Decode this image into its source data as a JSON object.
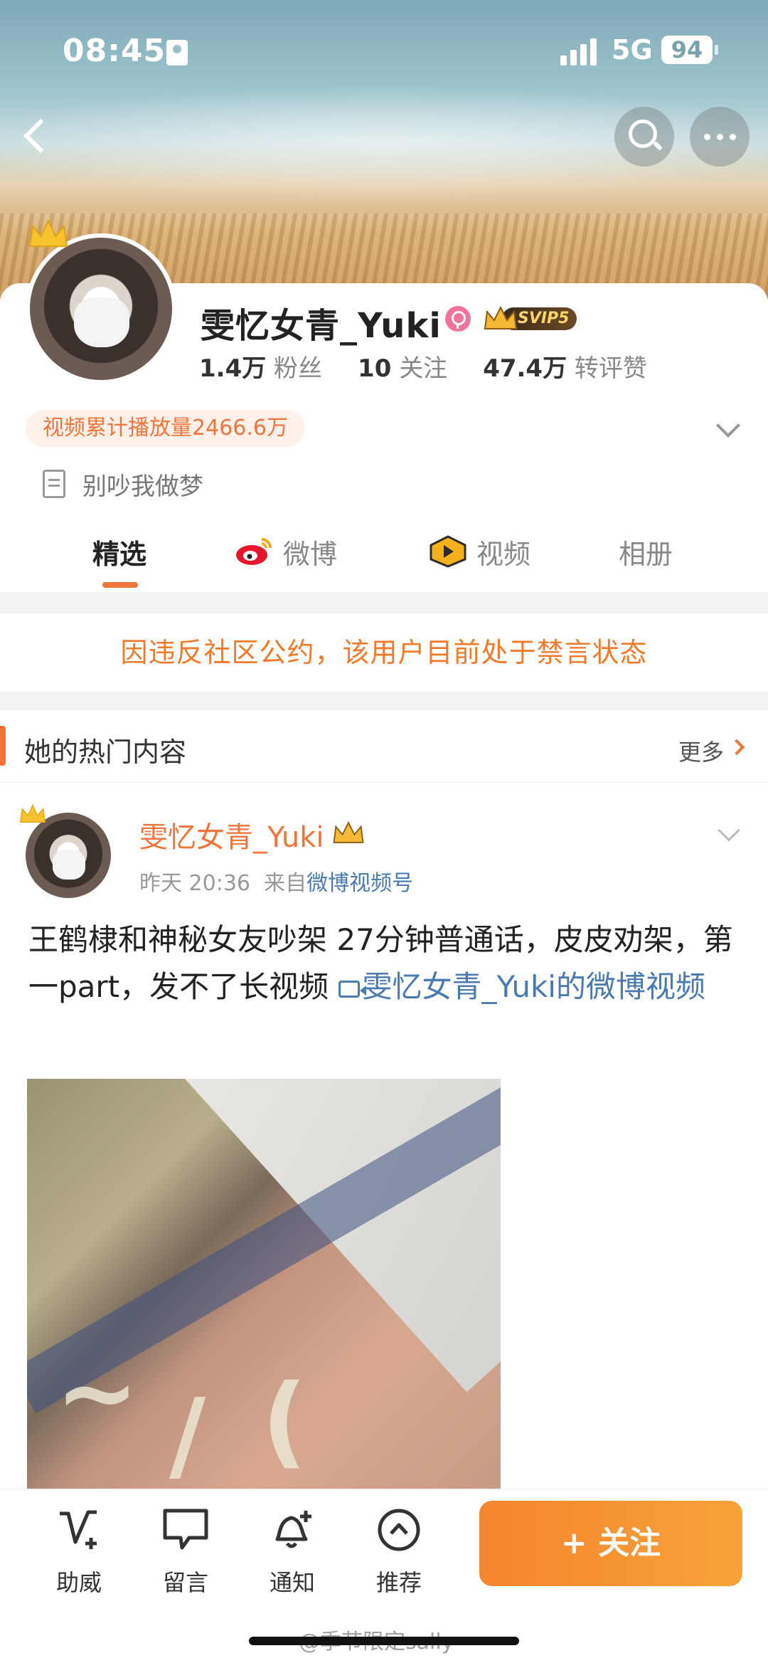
{
  "status_bar": {
    "time": "08:45",
    "network": "5G",
    "battery": "94"
  },
  "profile": {
    "name": "雯忆女青_Yuki",
    "svip": "SVIP5",
    "stats": [
      {
        "value": "1.4万",
        "label": "粉丝"
      },
      {
        "value": "10",
        "label": "关注"
      },
      {
        "value": "47.4万",
        "label": "转评赞"
      }
    ],
    "play_badge": "视频累计播放量2466.6万",
    "bio": "别吵我做梦"
  },
  "tabs": [
    {
      "label": "精选",
      "active": true
    },
    {
      "label": "微博",
      "icon": "weibo-icon"
    },
    {
      "label": "视频",
      "icon": "video-icon"
    },
    {
      "label": "相册"
    }
  ],
  "ban_notice": "因违反社区公约，该用户目前处于禁言状态",
  "hot": {
    "title": "她的热门内容",
    "more": "更多",
    "post": {
      "author": "雯忆女青_Yuki",
      "time": "昨天 20:36",
      "from_prefix": "来自",
      "source": "微博视频号",
      "text": "王鹤棣和神秘女友吵架 27分钟普通话，皮皮劝架，第一part，发不了长视频",
      "link": "雯忆女青_Yuki的微博视频"
    }
  },
  "bottom_bar": {
    "items": [
      {
        "label": "助威",
        "icon": "cheer-icon"
      },
      {
        "label": "留言",
        "icon": "message-icon"
      },
      {
        "label": "通知",
        "icon": "bell-add-icon"
      },
      {
        "label": "推荐",
        "icon": "recommend-icon"
      }
    ],
    "follow": "+ 关注"
  },
  "watermark": "@季节限定sally",
  "colors": {
    "accent": "#f0753a",
    "link": "#4a7ab0",
    "female": "#f0739f"
  }
}
